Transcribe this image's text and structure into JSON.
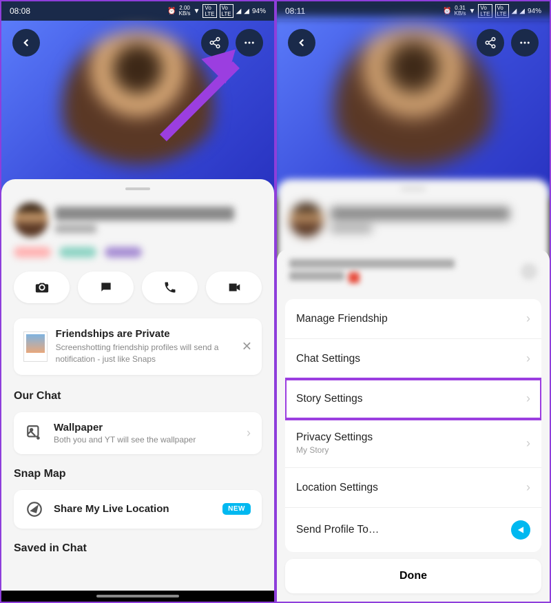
{
  "left": {
    "status": {
      "time": "08:08",
      "speed": "2.00",
      "speed_unit": "KB/s",
      "battery": "94%"
    },
    "info_card": {
      "title": "Friendships are Private",
      "subtitle": "Screenshotting friendship profiles will send a notification - just like Snaps"
    },
    "sections": {
      "our_chat": "Our Chat",
      "snap_map": "Snap Map",
      "saved": "Saved in Chat"
    },
    "wallpaper": {
      "title": "Wallpaper",
      "subtitle": "Both you and YT will see the wallpaper"
    },
    "share_location": {
      "title": "Share My Live Location",
      "badge": "NEW"
    }
  },
  "right": {
    "status": {
      "time": "08:11",
      "speed": "0.31",
      "speed_unit": "KB/s",
      "battery": "94%"
    },
    "menu": {
      "manage_friendship": "Manage Friendship",
      "chat_settings": "Chat Settings",
      "story_settings": "Story Settings",
      "privacy_settings": "Privacy Settings",
      "privacy_sub": "My Story",
      "location_settings": "Location Settings",
      "send_profile": "Send Profile To…",
      "done": "Done"
    }
  }
}
